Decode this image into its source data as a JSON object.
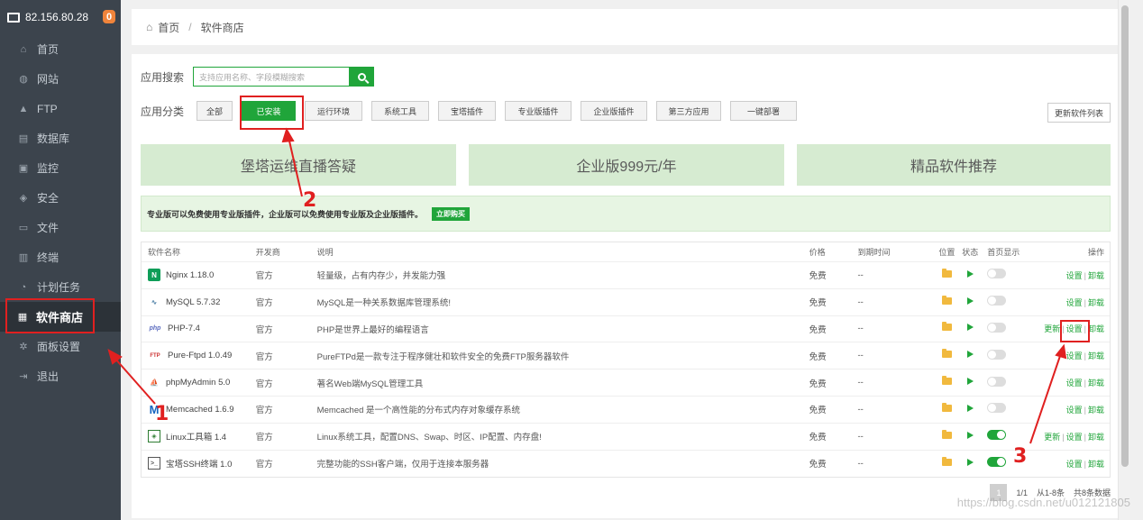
{
  "sidebar": {
    "ip": "82.156.80.28",
    "badge": "0",
    "items": [
      {
        "label": "首页",
        "icon": "home-icon",
        "glyph": "⌂"
      },
      {
        "label": "网站",
        "icon": "globe-icon",
        "glyph": "◍"
      },
      {
        "label": "FTP",
        "icon": "ftp-icon",
        "glyph": "▲"
      },
      {
        "label": "数据库",
        "icon": "database-icon",
        "glyph": "▤"
      },
      {
        "label": "监控",
        "icon": "monitor-icon",
        "glyph": "▣"
      },
      {
        "label": "安全",
        "icon": "shield-icon",
        "glyph": "◈"
      },
      {
        "label": "文件",
        "icon": "folder-icon",
        "glyph": "▭"
      },
      {
        "label": "终端",
        "icon": "terminal-icon",
        "glyph": "▥"
      },
      {
        "label": "计划任务",
        "icon": "clock-icon",
        "glyph": "◔"
      },
      {
        "label": "软件商店",
        "icon": "grid-icon",
        "glyph": "▦",
        "active": true
      },
      {
        "label": "面板设置",
        "icon": "gear-icon",
        "glyph": "✲"
      },
      {
        "label": "退出",
        "icon": "logout-icon",
        "glyph": "⇥"
      }
    ]
  },
  "breadcrumb": {
    "home": "首页",
    "sep": "/",
    "current": "软件商店"
  },
  "search": {
    "label": "应用搜索",
    "placeholder": "支持应用名称、字段模糊搜索"
  },
  "categories": {
    "label": "应用分类",
    "items": [
      "全部",
      "已安装",
      "运行环境",
      "系统工具",
      "宝塔插件",
      "专业版插件",
      "企业版插件",
      "第三方应用",
      "一键部署"
    ],
    "active_index": 1
  },
  "refresh_label": "更新软件列表",
  "banners": [
    "堡塔运维直播答疑",
    "企业版999元/年",
    "精品软件推荐"
  ],
  "notice": {
    "text": "专业版可以免费使用专业版插件，企业版可以免费使用专业版及企业版插件。",
    "button": "立即购买"
  },
  "table": {
    "headers": {
      "name": "软件名称",
      "dev": "开发商",
      "desc": "说明",
      "price": "价格",
      "expire": "到期时间",
      "location": "位置",
      "state": "状态",
      "home": "首页显示",
      "ops": "操作"
    },
    "rows": [
      {
        "name": "Nginx 1.18.0",
        "logo": "nginx-logo-icon",
        "dev": "官方",
        "desc": "轻量级，占有内存少，并发能力强",
        "price": "免费",
        "expire": "--",
        "home_on": false,
        "update": ""
      },
      {
        "name": "MySQL 5.7.32",
        "logo": "mysql-logo-icon",
        "dev": "官方",
        "desc": "MySQL是一种关系数据库管理系统!",
        "price": "免费",
        "expire": "--",
        "home_on": false,
        "update": ""
      },
      {
        "name": "PHP-7.4",
        "logo": "php-logo-icon",
        "dev": "官方",
        "desc": "PHP是世界上最好的编程语言",
        "price": "免费",
        "expire": "--",
        "home_on": false,
        "update": "更新"
      },
      {
        "name": "Pure-Ftpd 1.0.49",
        "logo": "ftp-logo-icon",
        "dev": "官方",
        "desc": "PureFTPd是一款专注于程序健壮和软件安全的免费FTP服务器软件",
        "price": "免费",
        "expire": "--",
        "home_on": false,
        "update": ""
      },
      {
        "name": "phpMyAdmin 5.0",
        "logo": "phpmyadmin-logo-icon",
        "dev": "官方",
        "desc": "著名Web端MySQL管理工具",
        "price": "免费",
        "expire": "--",
        "home_on": false,
        "update": ""
      },
      {
        "name": "Memcached 1.6.9",
        "logo": "memcached-logo-icon",
        "dev": "官方",
        "desc": "Memcached 是一个高性能的分布式内存对象缓存系统",
        "price": "免费",
        "expire": "--",
        "home_on": false,
        "update": ""
      },
      {
        "name": "Linux工具箱 1.4",
        "logo": "toolbox-logo-icon",
        "dev": "官方",
        "desc": "Linux系统工具，配置DNS、Swap、时区、IP配置、内存盘!",
        "price": "免费",
        "expire": "--",
        "home_on": true,
        "update": "更新"
      },
      {
        "name": "宝塔SSH终端 1.0",
        "logo": "ssh-terminal-logo-icon",
        "dev": "官方",
        "desc": "完整功能的SSH客户端，仅用于连接本服务器",
        "price": "免费",
        "expire": "--",
        "home_on": true,
        "update": ""
      }
    ],
    "op_settings": "设置",
    "op_uninstall": "卸载"
  },
  "pager": {
    "current": "1",
    "pages": "1/1",
    "range": "从1-8条",
    "total": "共8条数据"
  },
  "annotations": [
    "1",
    "2",
    "3"
  ],
  "colors": {
    "accent": "#20a53a",
    "annotation": "#e02020",
    "sidebar_bg": "#3c444d"
  },
  "watermark": "https://blog.csdn.net/u012121805"
}
